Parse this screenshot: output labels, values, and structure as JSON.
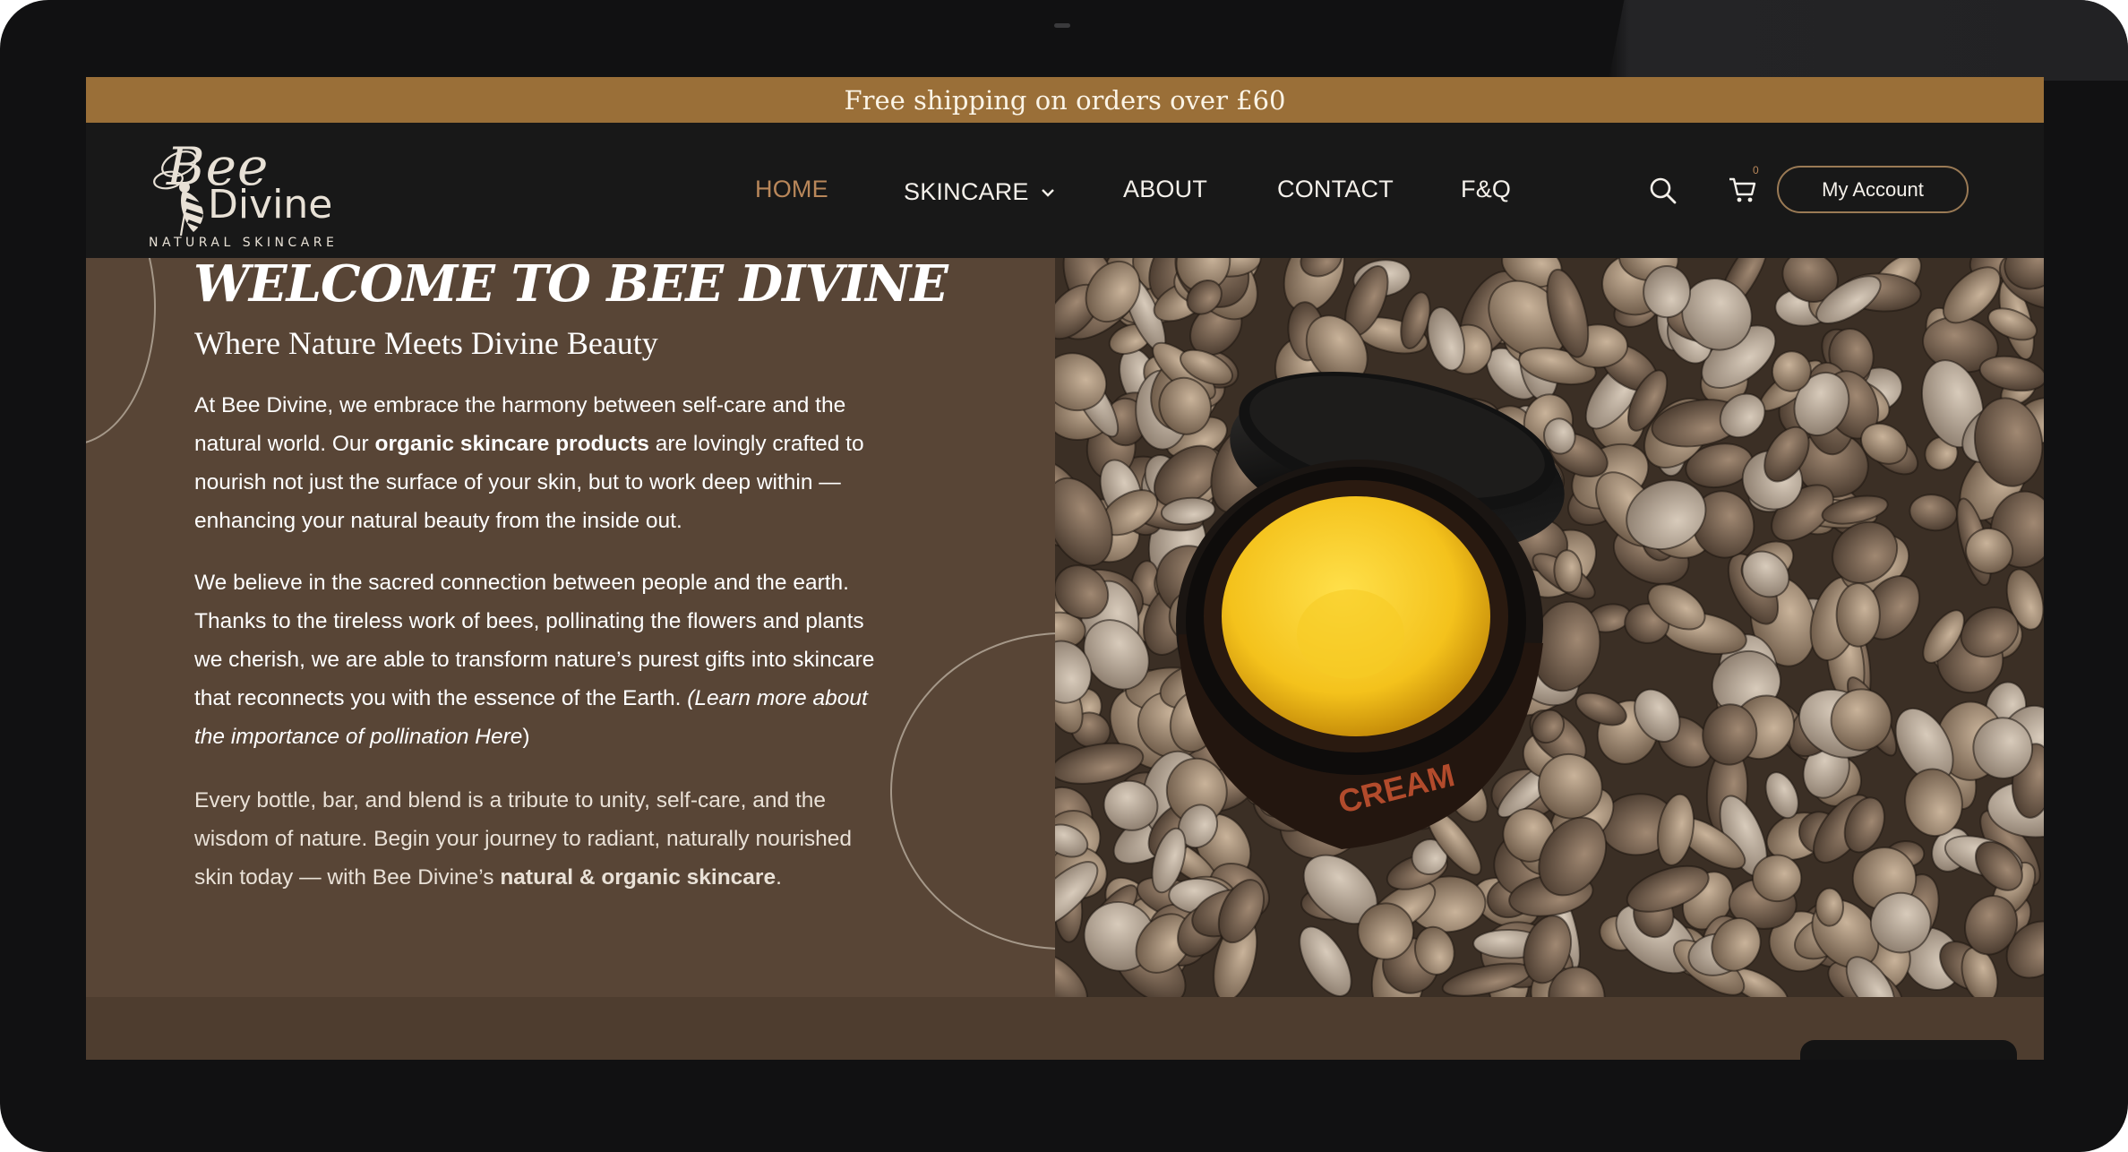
{
  "promo": {
    "text": "Free shipping on orders over £60"
  },
  "logo": {
    "line1": "Bee",
    "line2": "Divine",
    "tagline": "NATURAL SKINCARE"
  },
  "nav": {
    "items": [
      {
        "label": "HOME",
        "active": true
      },
      {
        "label": "SKINCARE",
        "has_dropdown": true
      },
      {
        "label": "ABOUT"
      },
      {
        "label": "CONTACT"
      },
      {
        "label": "F&Q"
      }
    ],
    "cart_count": "0",
    "account_label": "My Account",
    "icons": [
      "search-icon",
      "cart-icon",
      "chevron-down-icon"
    ]
  },
  "hero": {
    "title": "WELCOME TO BEE DIVINE",
    "subtitle": "Where Nature Meets Divine Beauty",
    "p1": {
      "a": "At Bee Divine, we embrace the harmony between self-care and the natural world. Our ",
      "b": "organic skincare products",
      "c": " are lovingly crafted to nourish not just the surface of your skin, but to work deep within — enhancing your natural beauty from the inside out."
    },
    "p2": {
      "a": "We believe in the sacred connection between people and the earth. Thanks to the tireless work of bees, pollinating the flowers and plants we cherish, we are able to transform nature’s purest gifts into skincare that reconnects you with the essence of the Earth. ",
      "b": "(Learn more about the importance of pollination Here",
      "c": ")"
    },
    "p3": {
      "a": "Every bottle, bar, and blend is a tribute to unity, self-care, and the wisdom of nature. Begin your journey to radiant, naturally nourished skin today — with Bee Divine’s ",
      "b": "natural & organic skincare",
      "c": "."
    },
    "image_label": "CREAM"
  },
  "colors": {
    "promo_bar": "#9a6f38",
    "header_bg": "#181818",
    "hero_bg": "#584536",
    "nav_active": "#b9875a",
    "cream_yellow": "#f4c21c"
  }
}
